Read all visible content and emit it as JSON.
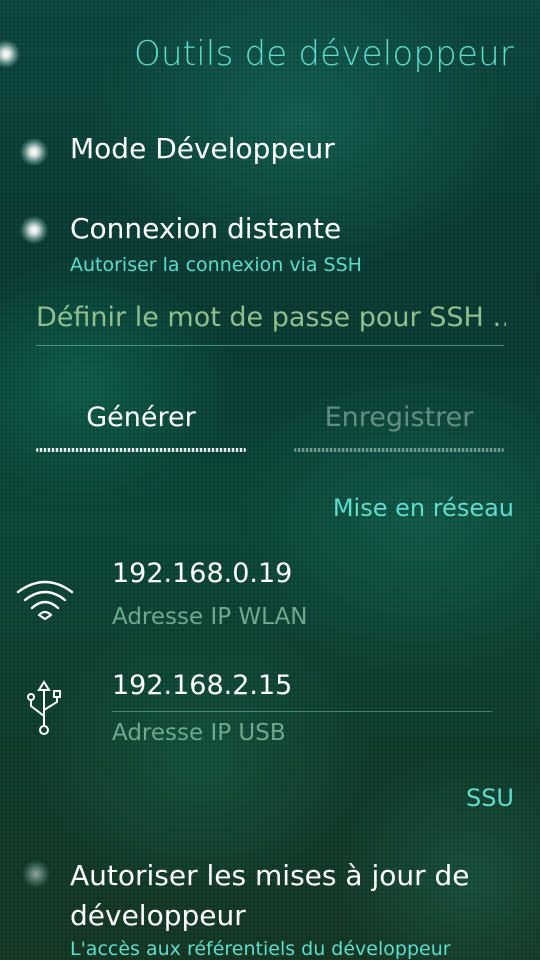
{
  "page": {
    "title": "Outils de développeur"
  },
  "developer_mode": {
    "label": "Mode Développeur"
  },
  "remote_connection": {
    "label": "Connexion distante",
    "description": "Autoriser la connexion via SSH"
  },
  "password_field": {
    "placeholder": "Définir le mot de passe pour SSH …"
  },
  "buttons": {
    "generate": "Générer",
    "save": "Enregistrer"
  },
  "networking": {
    "section_title": "Mise en réseau",
    "wlan": {
      "icon": "wifi-icon",
      "ip": "192.168.0.19",
      "label": "Adresse IP WLAN"
    },
    "usb": {
      "icon": "usb-icon",
      "ip": "192.168.2.15",
      "label": "Adresse IP USB"
    }
  },
  "ssu": {
    "section_title": "SSU",
    "developer_updates": {
      "label": "Autoriser les mises à jour de développeur",
      "description": "L'accès aux référentiels du développeur"
    }
  },
  "colors": {
    "highlight": "#5fdccb",
    "primary_text": "#ffffff",
    "secondary_text": "#6ea88e"
  }
}
